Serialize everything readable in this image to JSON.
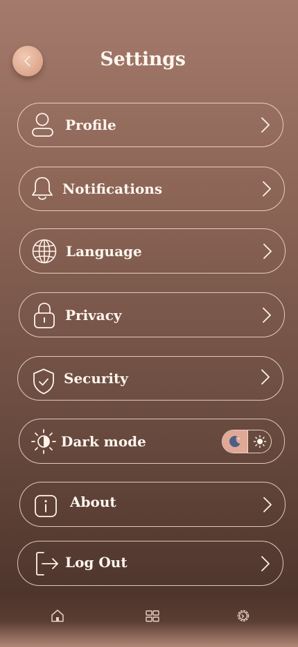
{
  "header": {
    "title": "Settings"
  },
  "menu": [
    {
      "label": "Profile",
      "icon": "user-icon"
    },
    {
      "label": "Notifications",
      "icon": "bell-icon"
    },
    {
      "label": "Language",
      "icon": "globe-icon"
    },
    {
      "label": "Privacy",
      "icon": "lock-icon"
    },
    {
      "label": "Security",
      "icon": "shield-check-icon"
    },
    {
      "label": "Dark mode",
      "icon": "contrast-icon",
      "toggle": {
        "state": "dark",
        "on_icon": "moon-icon",
        "off_icon": "sun-icon"
      }
    },
    {
      "label": "About",
      "icon": "info-icon"
    },
    {
      "label": "Log Out",
      "icon": "logout-icon"
    }
  ],
  "bottom_nav": [
    {
      "icon": "home-icon"
    },
    {
      "icon": "grid-icon"
    },
    {
      "icon": "gear-icon"
    }
  ],
  "colors": {
    "toggle_active": "#e1a896",
    "back_button": "#dca78d",
    "moon": "#4b5f86"
  }
}
